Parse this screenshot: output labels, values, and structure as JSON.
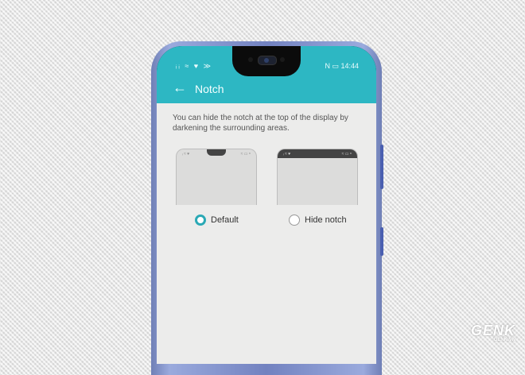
{
  "status_bar": {
    "left_icons": "ᵢᵢ ≈ ♥ ≫",
    "right_text": "N ▭ 14:44"
  },
  "appbar": {
    "back_icon": "←",
    "title": "Notch"
  },
  "content": {
    "description": "You can hide the notch at the top of the display by darkening the surrounding areas.",
    "options": [
      {
        "label": "Default",
        "selected": true
      },
      {
        "label": "Hide notch",
        "selected": false
      }
    ],
    "preview_left_icons": "ᵢ ≈ ♥",
    "preview_right_icons": "≈ ▭ ⁸"
  },
  "watermark": {
    "brand": "GENK",
    "sub": "GENK.VN"
  },
  "colors": {
    "accent": "#2db7c3",
    "radio": "#2ba9b5"
  }
}
